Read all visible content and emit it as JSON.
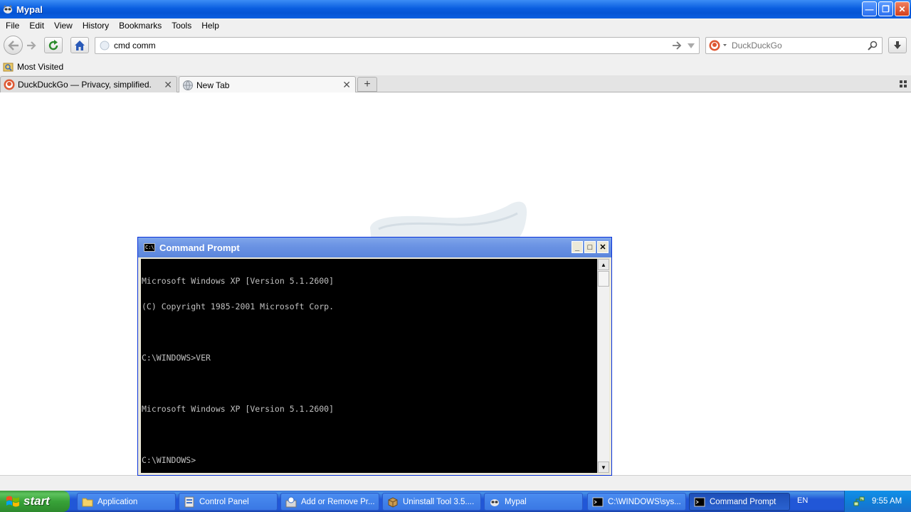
{
  "window": {
    "title": "Mypal"
  },
  "menu": [
    "File",
    "Edit",
    "View",
    "History",
    "Bookmarks",
    "Tools",
    "Help"
  ],
  "nav": {
    "url_value": "cmd comm",
    "search_placeholder": "DuckDuckGo"
  },
  "bookmarks": {
    "most_visited": "Most Visited"
  },
  "tabs": [
    {
      "label": "DuckDuckGo — Privacy, simplified."
    },
    {
      "label": "New Tab"
    }
  ],
  "cmd": {
    "title": "Command Prompt",
    "lines": [
      "Microsoft Windows XP [Version 5.1.2600]",
      "(C) Copyright 1985-2001 Microsoft Corp.",
      "",
      "C:\\WINDOWS>VER",
      "",
      "Microsoft Windows XP [Version 5.1.2600]",
      "",
      "C:\\WINDOWS>"
    ]
  },
  "taskbar": {
    "start": "start",
    "items": [
      {
        "label": "Application"
      },
      {
        "label": "Control Panel"
      },
      {
        "label": "Add or Remove Pr..."
      },
      {
        "label": "Uninstall Tool 3.5...."
      },
      {
        "label": "Mypal"
      },
      {
        "label": "C:\\WINDOWS\\sys..."
      },
      {
        "label": "Command Prompt"
      }
    ],
    "lang": "EN",
    "clock": "9:55 AM"
  }
}
